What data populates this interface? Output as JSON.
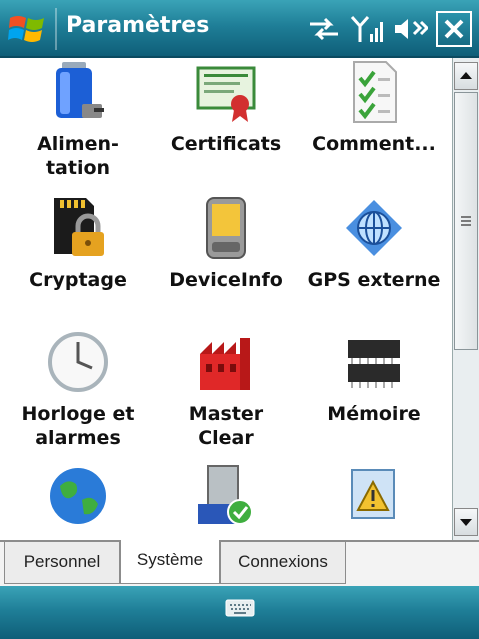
{
  "titlebar": {
    "title": "Paramètres"
  },
  "icons": {
    "start": "windows-flag-icon",
    "sync": "sync-arrows-icon",
    "signal": "signal-strength-icon",
    "volume": "speaker-muted-icon",
    "close": "close-icon",
    "keyboard": "keyboard-icon"
  },
  "grid": {
    "items": [
      {
        "label": "Alimen-\ntation",
        "icon": "battery-icon"
      },
      {
        "label": "Certificats",
        "icon": "certificate-icon"
      },
      {
        "label": "Comment...",
        "icon": "checklist-icon"
      },
      {
        "label": "Cryptage",
        "icon": "sd-card-lock-icon"
      },
      {
        "label": "DeviceInfo",
        "icon": "pda-device-icon"
      },
      {
        "label": "GPS externe",
        "icon": "gps-globe-icon"
      },
      {
        "label": "Horloge et\nalarmes",
        "icon": "clock-icon"
      },
      {
        "label": "Master\nClear",
        "icon": "factory-icon"
      },
      {
        "label": "Mémoire",
        "icon": "memory-chip-icon"
      },
      {
        "label": "",
        "icon": "globe-icon"
      },
      {
        "label": "",
        "icon": "building-check-icon"
      },
      {
        "label": "",
        "icon": "warning-window-icon"
      }
    ]
  },
  "tabs": [
    {
      "label": "Personnel",
      "active": false
    },
    {
      "label": "Système",
      "active": true
    },
    {
      "label": "Connexions",
      "active": false
    }
  ]
}
